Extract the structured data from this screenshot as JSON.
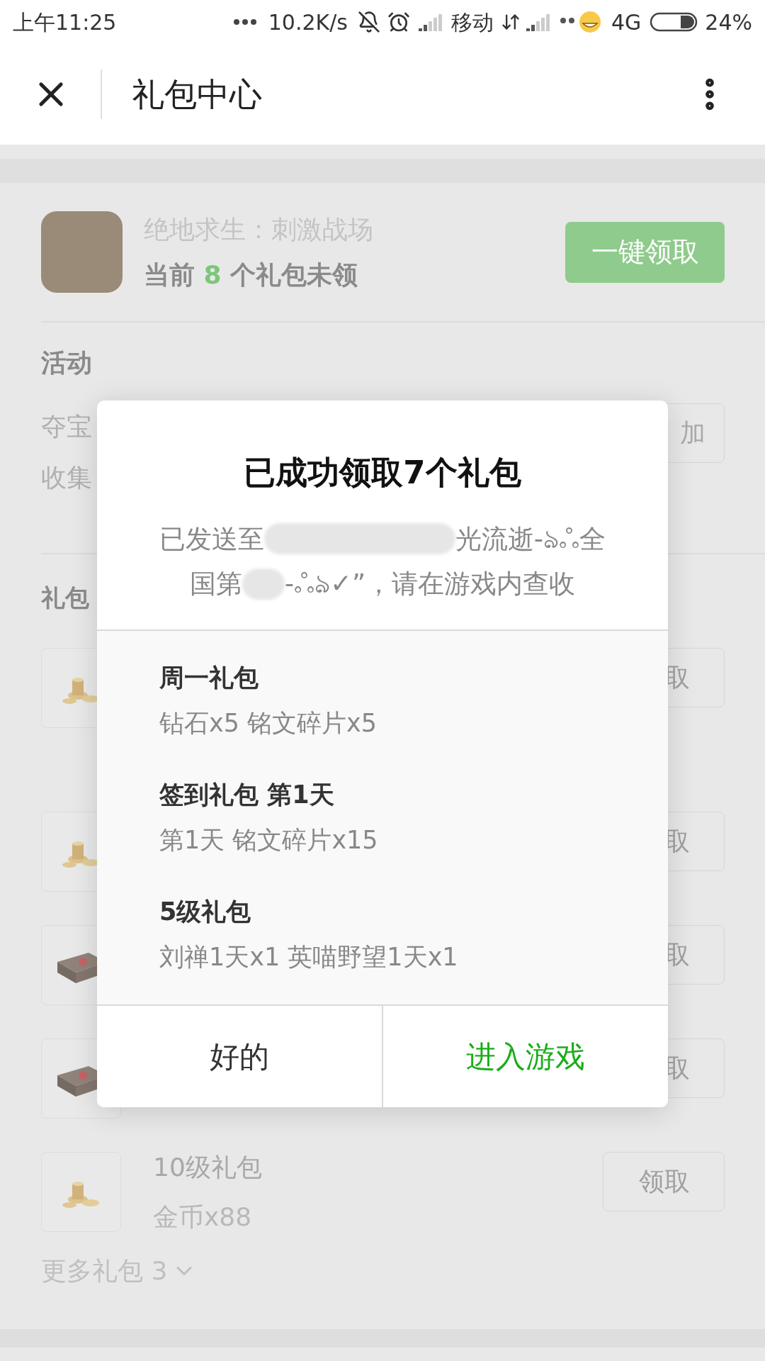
{
  "status_bar": {
    "time": "上午11:25",
    "speed": "10.2K/s",
    "carrier": "移动",
    "network": "4G",
    "battery": "24%"
  },
  "header": {
    "title": "礼包中心"
  },
  "game": {
    "name": "绝地求生：刺激战场",
    "count_prefix": "当前",
    "count": "8",
    "count_suffix": "个礼包未领",
    "claim_all": "一键领取"
  },
  "activity": {
    "heading": "活动",
    "lines": [
      "夺宝",
      "收集"
    ],
    "button": "加"
  },
  "gifts": {
    "heading": "礼包",
    "rows": [
      {
        "kind": "coins",
        "button": "取"
      },
      {
        "kind": "coins",
        "button": "取"
      },
      {
        "kind": "chest",
        "button": "取"
      },
      {
        "kind": "chest",
        "button": "取"
      },
      {
        "kind": "coins",
        "title": "10级礼包",
        "detail": "金币x88",
        "button": "领取"
      }
    ],
    "more": "更多礼包 3"
  },
  "dialog": {
    "title": "已成功领取7个礼包",
    "message": [
      [
        {
          "kind": "text",
          "text": "已发送至"
        },
        {
          "kind": "blurred"
        },
        {
          "kind": "text",
          "text": "光流逝-ঌஃ全"
        }
      ],
      [
        {
          "kind": "text",
          "text": "国第"
        },
        {
          "kind": "blurred"
        },
        {
          "kind": "text",
          "text": "-ஃঌ✓”，请在游戏内查收"
        }
      ]
    ],
    "items": [
      {
        "title": "周一礼包",
        "detail": "钻石x5 铭文碎片x5"
      },
      {
        "title": "签到礼包 第1天",
        "detail": "第1天 铭文碎片x15"
      },
      {
        "title": "5级礼包",
        "detail": "刘禅1天x1 英喵野望1天x1"
      }
    ],
    "buttons": [
      {
        "label": "好的",
        "primary": false
      },
      {
        "label": "进入游戏",
        "primary": true
      }
    ]
  }
}
